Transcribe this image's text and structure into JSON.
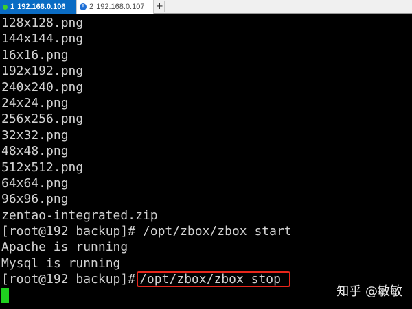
{
  "tabs": [
    {
      "index": "1",
      "label": "192.168.0.106",
      "active": true
    },
    {
      "index": "2",
      "label": "192.168.0.107",
      "active": false,
      "icon": "warning-icon"
    }
  ],
  "new_tab_label": "+",
  "terminal": {
    "lines": [
      "128x128.png",
      "144x144.png",
      "16x16.png",
      "192x192.png",
      "240x240.png",
      "24x24.png",
      "256x256.png",
      "32x32.png",
      "48x48.png",
      "512x512.png",
      "64x64.png",
      "96x96.png",
      "zentao-integrated.zip",
      "[root@192 backup]# /opt/zbox/zbox start",
      "Apache is running",
      "Mysql is running"
    ],
    "last_prompt": "[root@192 backup]#",
    "last_command": "/opt/zbox/zbox stop"
  },
  "watermark": "知乎 @敏敏",
  "colors": {
    "terminal_bg": "#000000",
    "terminal_fg": "#d2d2d2",
    "active_tab": "#0a6cc4",
    "highlight": "#e8261b",
    "cursor": "#1fd11f",
    "status_ok": "#3ecf2e"
  }
}
